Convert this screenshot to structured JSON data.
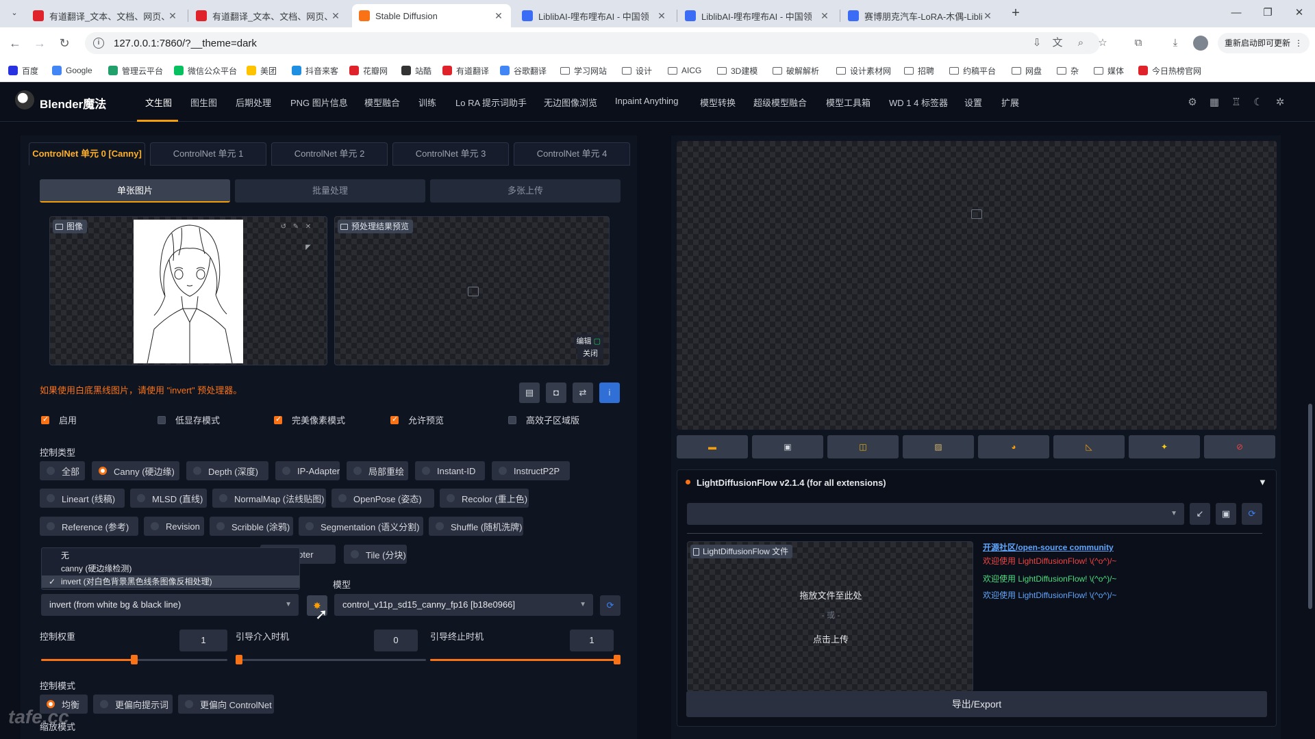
{
  "browser": {
    "tabs": [
      {
        "title": "有道翻译_文本、文档、网页、",
        "icon": "youdao",
        "color": "#e0232b"
      },
      {
        "title": "有道翻译_文本、文档、网页、",
        "icon": "youdao",
        "color": "#e0232b"
      },
      {
        "title": "Stable Diffusion",
        "icon": "sd",
        "color": "#f97316"
      },
      {
        "title": "LiblibAI-哩布哩布AI - 中国领",
        "icon": "liblib",
        "color": "#3b6cf6"
      },
      {
        "title": "LiblibAI-哩布哩布AI - 中国领",
        "icon": "liblib",
        "color": "#3b6cf6"
      },
      {
        "title": "赛博朋克汽车-LoRA-木偶-Libli",
        "icon": "liblib",
        "color": "#3b6cf6"
      }
    ],
    "new_tab": "+",
    "url": "127.0.0.1:7860/?__theme=dark",
    "update_button": "重新启动即可更新",
    "bookmarks": [
      {
        "label": "百度",
        "icon": "baidu",
        "color": "#2932e1"
      },
      {
        "label": "Google",
        "icon": "google",
        "color": "#4285f4"
      },
      {
        "label": "管理云平台",
        "icon": "cloud",
        "color": "#22a06b"
      },
      {
        "label": "微信公众平台",
        "icon": "wechat",
        "color": "#07c160"
      },
      {
        "label": "美团",
        "icon": "meituan",
        "color": "#ffc300"
      },
      {
        "label": "抖音来客",
        "icon": "douyin",
        "color": "#1e8fe1"
      },
      {
        "label": "花瓣网",
        "icon": "huaban",
        "color": "#e0232b"
      },
      {
        "label": "站酷",
        "icon": "zcool",
        "color": "#333333"
      },
      {
        "label": "有道翻译",
        "icon": "youdao",
        "color": "#e0232b"
      },
      {
        "label": "谷歌翻译",
        "icon": "gtranslate",
        "color": "#4285f4"
      },
      {
        "label": "学习网站",
        "icon": "folder"
      },
      {
        "label": "设计",
        "icon": "folder"
      },
      {
        "label": "AICG",
        "icon": "folder"
      },
      {
        "label": "3D建模",
        "icon": "folder"
      },
      {
        "label": "破解解析",
        "icon": "folder"
      },
      {
        "label": "设计素材网",
        "icon": "folder"
      },
      {
        "label": "招聘",
        "icon": "folder"
      },
      {
        "label": "约稿平台",
        "icon": "folder"
      },
      {
        "label": "网盘",
        "icon": "folder"
      },
      {
        "label": "杂",
        "icon": "folder"
      },
      {
        "label": "媒体",
        "icon": "folder"
      },
      {
        "label": "今日热榜官网",
        "icon": "rebang",
        "color": "#e0232b"
      }
    ]
  },
  "app": {
    "brand": "Blender魔法",
    "nav": [
      "文生图",
      "图生图",
      "后期处理",
      "PNG 图片信息",
      "模型融合",
      "训练",
      "Lo RA 提示词助手",
      "无边图像浏览",
      "Inpaint Anything",
      "模型转换",
      "超级模型融合",
      "模型工具箱",
      "WD 1 4 标签器",
      "设置",
      "扩展"
    ],
    "nav_active": "文生图"
  },
  "controlnet": {
    "units": [
      "ControlNet 单元 0 [Canny]",
      "ControlNet 单元 1",
      "ControlNet 单元 2",
      "ControlNet 单元 3",
      "ControlNet 单元 4"
    ],
    "subtabs": [
      "单张图片",
      "批量处理",
      "多张上传"
    ],
    "image_label": "图像",
    "preview_label": "预处理结果预览",
    "edit_label": "编辑",
    "close_label": "关闭",
    "hint": "如果使用白底黑线图片，请使用 \"invert\" 预处理器。",
    "checkboxes": [
      {
        "label": "启用",
        "checked": true
      },
      {
        "label": "低显存模式",
        "checked": false
      },
      {
        "label": "完美像素模式",
        "checked": true
      },
      {
        "label": "允许预览",
        "checked": true
      },
      {
        "label": "高效子区域版",
        "checked": false
      }
    ],
    "control_type_label": "控制类型",
    "control_types_row1": [
      "全部",
      "Canny (硬边缘)",
      "Depth (深度)",
      "IP-Adapter",
      "局部重绘",
      "Instant-ID",
      "InstructP2P"
    ],
    "control_types_row2": [
      "Lineart (线稿)",
      "MLSD (直线)",
      "NormalMap (法线贴图)",
      "OpenPose (姿态)",
      "Recolor (重上色)"
    ],
    "control_types_row3": [
      "Reference (参考)",
      "Revision",
      "Scribble (涂鸦)",
      "Segmentation (语义分割)",
      "Shuffle (随机洗牌)"
    ],
    "control_types_row4": [
      "Adapter",
      "Tile (分块)"
    ],
    "selected_type": "Canny (硬边缘)",
    "preprocessor_options": [
      "无",
      "canny (硬边缘检测)",
      "invert (对白色背景黑色线条图像反相处理)"
    ],
    "preprocessor_value": "invert (from white bg & black line)",
    "model_label": "模型",
    "model_value": "control_v11p_sd15_canny_fp16 [b18e0966]",
    "weight_label": "控制权重",
    "weight_value": "1",
    "weight_fraction": 0.5,
    "start_label": "引导介入时机",
    "start_value": "0",
    "end_label": "引导终止时机",
    "end_value": "1",
    "mode_label": "控制模式",
    "modes": [
      "均衡",
      "更偏向提示词",
      "更偏向 ControlNet"
    ],
    "selected_mode": "均衡",
    "resize_label": "缩放模式"
  },
  "ldf": {
    "title": "LightDiffusionFlow v2.1.4 (for all extensions)",
    "file_label": "LightDiffusionFlow 文件",
    "drop_text": "拖放文件至此处",
    "or_text": "- 或 -",
    "upload_text": "点击上传",
    "community_link": "开源社区/open-source community",
    "welcome_red": "欢迎使用 LightDiffusionFlow! \\(^o^)/~",
    "welcome_green": "欢迎使用 LightDiffusionFlow! \\(^o^)/~",
    "welcome_blue": "欢迎使用 LightDiffusionFlow! \\(^o^)/~",
    "export": "导出/Export"
  },
  "watermark": "tafe.cc"
}
